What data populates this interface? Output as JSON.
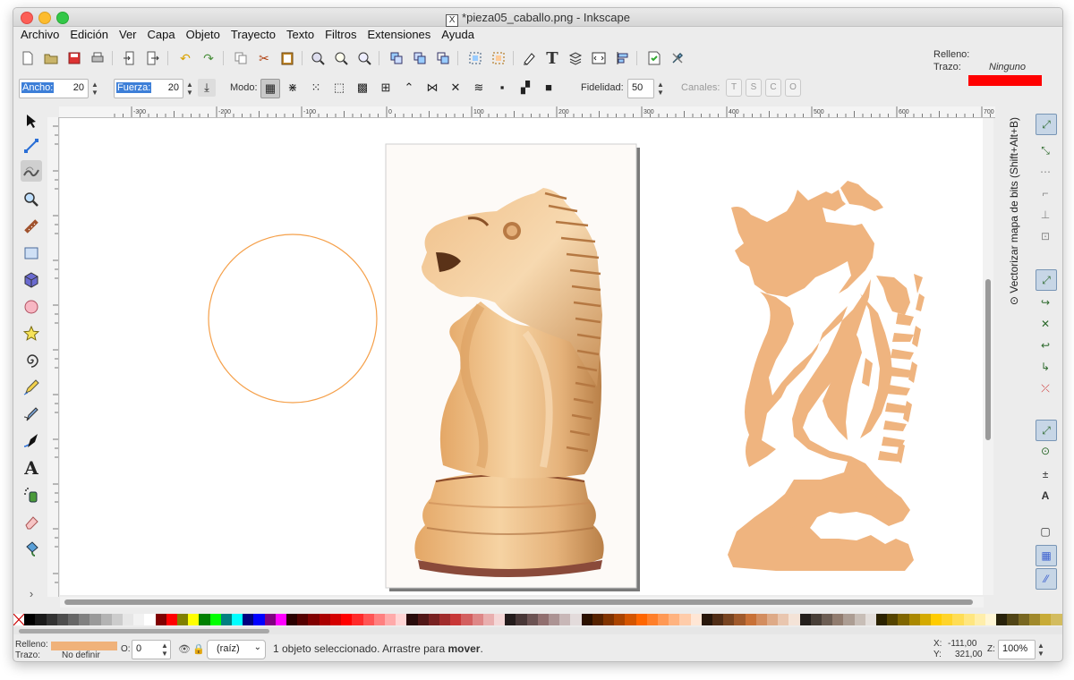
{
  "window": {
    "title": "*pieza05_caballo.png - Inkscape"
  },
  "menu": [
    "Archivo",
    "Edición",
    "Ver",
    "Capa",
    "Objeto",
    "Trayecto",
    "Texto",
    "Filtros",
    "Extensiones",
    "Ayuda"
  ],
  "tweak_controls": {
    "width_label": "Ancho:",
    "width_value": "20",
    "force_label": "Fuerza:",
    "force_value": "20",
    "mode_label": "Modo:",
    "fidelity_label": "Fidelidad:",
    "fidelity_value": "50",
    "channels_label": "Canales:",
    "channels": [
      "T",
      "S",
      "C",
      "O"
    ]
  },
  "style_indicator": {
    "fill_label": "Relleno:",
    "stroke_label": "Trazo:",
    "stroke_value": "Ninguno",
    "fill_color": "#ff0000"
  },
  "ruler_labels": [
    "-300",
    "-200",
    "-100",
    "0",
    "100",
    "200",
    "300",
    "400",
    "500",
    "600",
    "700"
  ],
  "docked_dialog": {
    "title": "Vectorizar mapa de bits (Shift+Alt+B)"
  },
  "canvas": {
    "circle_stroke": "#f5a04a",
    "trace_fill": "#efb47f"
  },
  "status": {
    "fill_label": "Relleno:",
    "stroke_label": "Trazo:",
    "stroke_value": "No definir",
    "fill_color": "#f0b27a",
    "opacity_label": "O:",
    "opacity_value": "0",
    "layer_value": "(raíz)",
    "message_prefix": "1 objeto seleccionado. Arrastre para ",
    "message_bold": "mover",
    "message_suffix": ".",
    "x_label": "X:",
    "x_value": "-111,00",
    "y_label": "Y:",
    "y_value": "321,00",
    "zoom_label": "Z:",
    "zoom_value": "100%"
  },
  "palette_colors": [
    "#000000",
    "#1a1a1a",
    "#333333",
    "#4d4d4d",
    "#666666",
    "#808080",
    "#999999",
    "#b3b3b3",
    "#cccccc",
    "#e6e6e6",
    "#f2f2f2",
    "#ffffff",
    "#800000",
    "#ff0000",
    "#808000",
    "#ffff00",
    "#008000",
    "#00ff00",
    "#008080",
    "#00ffff",
    "#000080",
    "#0000ff",
    "#800080",
    "#ff00ff",
    "#2b0000",
    "#550000",
    "#800000",
    "#aa0000",
    "#d40000",
    "#ff0000",
    "#ff2a2a",
    "#ff5555",
    "#ff8080",
    "#ffaaaa",
    "#ffd5d5",
    "#280b0b",
    "#501616",
    "#782121",
    "#a02c2c",
    "#c83737",
    "#d35f5f",
    "#de8787",
    "#e9afaf",
    "#f4d7d7",
    "#241c1c",
    "#483737",
    "#6c5353",
    "#916f6f",
    "#ac9393",
    "#c8b7b7",
    "#e3dbdb",
    "#2b1100",
    "#552200",
    "#803300",
    "#aa4400",
    "#d45500",
    "#ff6600",
    "#ff7f2a",
    "#ff9955",
    "#ffb380",
    "#ffccaa",
    "#ffe6d5",
    "#28170b",
    "#502d16",
    "#784421",
    "#a05a2c",
    "#c87137",
    "#d38d5f",
    "#deaa87",
    "#e9c6af",
    "#f4e3d7",
    "#241f1c",
    "#483e37",
    "#6c5d53",
    "#917c6f",
    "#ac9d93",
    "#c8beb7",
    "#e3dedb",
    "#2b2200",
    "#554400",
    "#806600",
    "#aa8800",
    "#d4aa00",
    "#ffcc00",
    "#ffd42a",
    "#ffdd55",
    "#ffe680",
    "#ffeeaa",
    "#fff6d5",
    "#28220b",
    "#504416",
    "#786721",
    "#a0892c",
    "#c8ab37",
    "#d3bc5f"
  ]
}
